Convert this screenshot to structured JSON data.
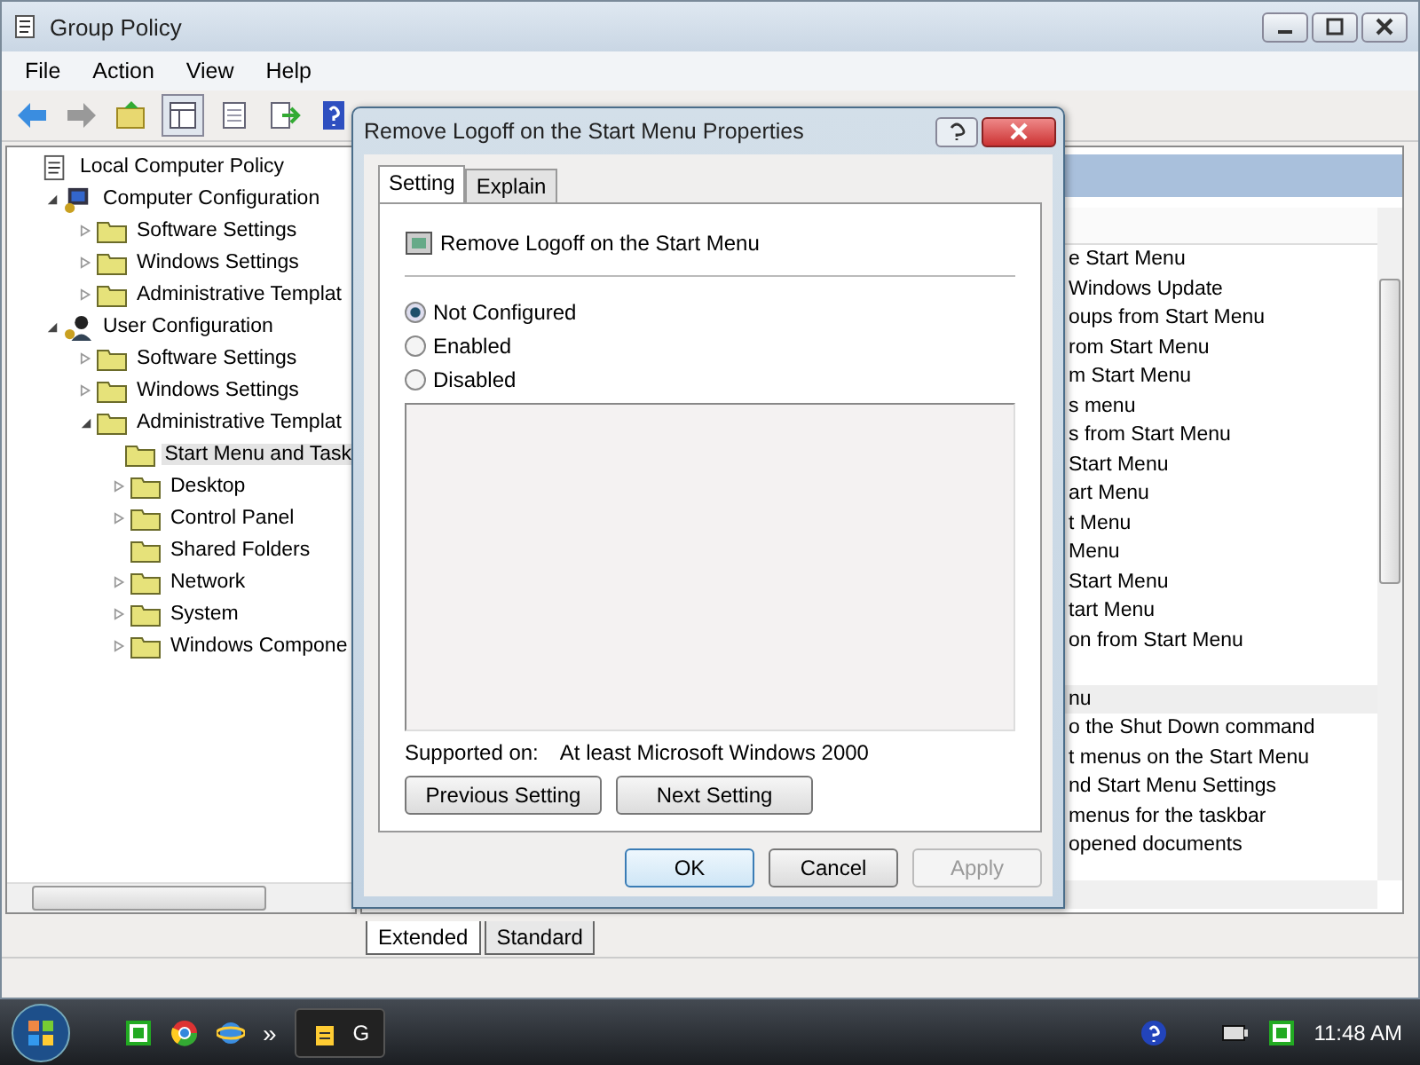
{
  "window": {
    "title": "Group Policy"
  },
  "menu": [
    "File",
    "Action",
    "View",
    "Help"
  ],
  "tree": [
    {
      "label": "Local Computer Policy",
      "kind": "policy",
      "children": [
        {
          "label": "Computer Configuration",
          "kind": "computer",
          "expanded": true,
          "children": [
            {
              "label": "Software Settings",
              "kind": "folder",
              "expanded": false
            },
            {
              "label": "Windows Settings",
              "kind": "folder",
              "expanded": false
            },
            {
              "label": "Administrative Templat",
              "kind": "folder",
              "expanded": false
            }
          ]
        },
        {
          "label": "User Configuration",
          "kind": "user",
          "expanded": true,
          "children": [
            {
              "label": "Software Settings",
              "kind": "folder",
              "expanded": false
            },
            {
              "label": "Windows Settings",
              "kind": "folder",
              "expanded": false
            },
            {
              "label": "Administrative Templat",
              "kind": "folder",
              "expanded": true,
              "children": [
                {
                  "label": "Start Menu and Task",
                  "kind": "folder",
                  "selected": true
                },
                {
                  "label": "Desktop",
                  "kind": "folder",
                  "expanded": false,
                  "selected": false
                },
                {
                  "label": "Control Panel",
                  "kind": "folder",
                  "expanded": false,
                  "selected": false
                },
                {
                  "label": "Shared Folders",
                  "kind": "folder",
                  "selected": false
                },
                {
                  "label": "Network",
                  "kind": "folder",
                  "expanded": false,
                  "selected": false
                },
                {
                  "label": "System",
                  "kind": "folder",
                  "expanded": false,
                  "selected": false
                },
                {
                  "label": "Windows Compone",
                  "kind": "folder",
                  "expanded": false,
                  "selected": false
                }
              ]
            }
          ]
        }
      ]
    }
  ],
  "settings_list": {
    "rows": [
      {
        "kind": "text",
        "text": "e Start Menu",
        "selected": false
      },
      {
        "kind": "text",
        "text": "Windows Update",
        "selected": false
      },
      {
        "kind": "text",
        "text": "oups from Start Menu",
        "selected": false
      },
      {
        "kind": "text",
        "text": "rom Start Menu",
        "selected": false
      },
      {
        "kind": "text",
        "text": "m Start Menu",
        "selected": false
      },
      {
        "kind": "text",
        "text": "s menu",
        "selected": false
      },
      {
        "kind": "text",
        "text": "s from Start Menu",
        "selected": false
      },
      {
        "kind": "text",
        "text": "Start Menu",
        "selected": false
      },
      {
        "kind": "text",
        "text": "art Menu",
        "selected": false
      },
      {
        "kind": "text",
        "text": "t Menu",
        "selected": false
      },
      {
        "kind": "text",
        "text": "Menu",
        "selected": false
      },
      {
        "kind": "text",
        "text": "Start Menu",
        "selected": false
      },
      {
        "kind": "text",
        "text": "tart Menu",
        "selected": false
      },
      {
        "kind": "text",
        "text": "on from Start Menu",
        "selected": false
      },
      {
        "kind": "hidden"
      },
      {
        "kind": "text",
        "text": "nu",
        "selected": true
      },
      {
        "kind": "text",
        "text": "o the Shut Down command",
        "selected": false
      },
      {
        "kind": "text",
        "text": "t menus on the Start Menu",
        "selected": false
      },
      {
        "kind": "text",
        "text": "nd Start Menu Settings",
        "selected": false
      },
      {
        "kind": "text",
        "text": "menus for the taskbar",
        "selected": false
      },
      {
        "kind": "text",
        "text": "opened documents",
        "selected": false
      }
    ]
  },
  "view_tabs": [
    {
      "label": "Extended",
      "selected": true
    },
    {
      "label": "Standard",
      "selected": false
    }
  ],
  "dialog": {
    "title": "Remove Logoff on the Start Menu Properties",
    "tabs": [
      {
        "label": "Setting",
        "selected": true
      },
      {
        "label": "Explain",
        "selected": false
      }
    ],
    "policy_name": "Remove Logoff on the Start Menu",
    "options": [
      {
        "label": "Not Configured",
        "selected": true
      },
      {
        "label": "Enabled",
        "selected": false
      },
      {
        "label": "Disabled",
        "selected": false
      }
    ],
    "supported_label": "Supported on:",
    "supported_value": "At least Microsoft Windows 2000",
    "nav_buttons": [
      "Previous Setting",
      "Next Setting"
    ],
    "buttons": [
      {
        "label": "OK",
        "kind": "default",
        "disabled": false
      },
      {
        "label": "Cancel",
        "kind": "normal",
        "disabled": false
      },
      {
        "label": "Apply",
        "kind": "normal",
        "disabled": true
      }
    ]
  },
  "taskbar": {
    "overflow": "»",
    "task_label": "G",
    "clock": "11:48 AM"
  }
}
